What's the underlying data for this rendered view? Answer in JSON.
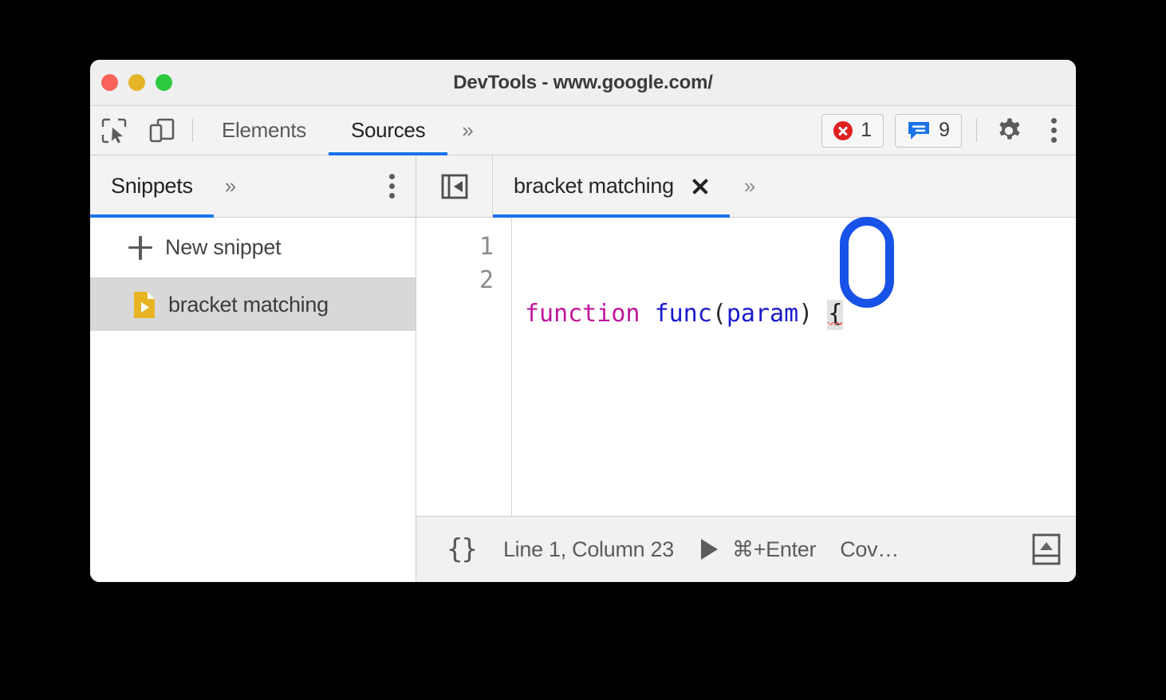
{
  "window": {
    "title": "DevTools - www.google.com/",
    "traffic_lights": [
      {
        "name": "close",
        "color": "#f96258"
      },
      {
        "name": "minimize",
        "color": "#e5b327"
      },
      {
        "name": "maximize",
        "color": "#2dc93f"
      }
    ]
  },
  "toolbar": {
    "inspect_icon": "inspect-element-icon",
    "device_icon": "device-toolbar-icon",
    "tabs": [
      {
        "label": "Elements",
        "active": false
      },
      {
        "label": "Sources",
        "active": true
      }
    ],
    "overflow_label": "»",
    "error_badge": {
      "icon": "error-circle-icon",
      "count": "1",
      "color": "#e02020"
    },
    "message_badge": {
      "icon": "message-bubble-icon",
      "count": "9",
      "color": "#1a73e8"
    },
    "settings_icon": "gear-icon",
    "more_icon": "kebab-menu-icon"
  },
  "sidebar": {
    "tab_label": "Snippets",
    "overflow_label": "»",
    "more_icon": "kebab-menu-icon",
    "new_snippet_label": "New snippet",
    "items": [
      {
        "label": "bracket matching",
        "icon": "snippet-file-icon",
        "selected": true
      }
    ]
  },
  "editor": {
    "sidebar_toggle_icon": "show-navigator-icon",
    "tab_label": "bracket matching",
    "close_label": "×",
    "overflow_label": "»",
    "line_numbers": [
      "1",
      "2"
    ],
    "code": {
      "keyword": "function",
      "space1": " ",
      "fn_name": "func",
      "open_paren": "(",
      "param": "param",
      "close_paren": ")",
      "space2": " ",
      "brace": "{"
    },
    "code_colors": {
      "keyword": "#c0169b",
      "identifier": "#1a1acc",
      "punctuation": "#2a2a2a",
      "brace_highlight_bg": "#e2e2e2",
      "error_underline": "#e86b6b"
    }
  },
  "statusbar": {
    "pretty_print_label": "{}",
    "position_label": "Line 1, Column 23",
    "run_icon": "run-triangle-icon",
    "shortcut_label": "⌘+Enter",
    "coverage_label": "Cov…",
    "drawer_icon": "show-drawer-icon"
  },
  "annotation": {
    "shape": "rounded-rect-highlight",
    "color": "#1853e8",
    "target": "open-curly-brace"
  }
}
